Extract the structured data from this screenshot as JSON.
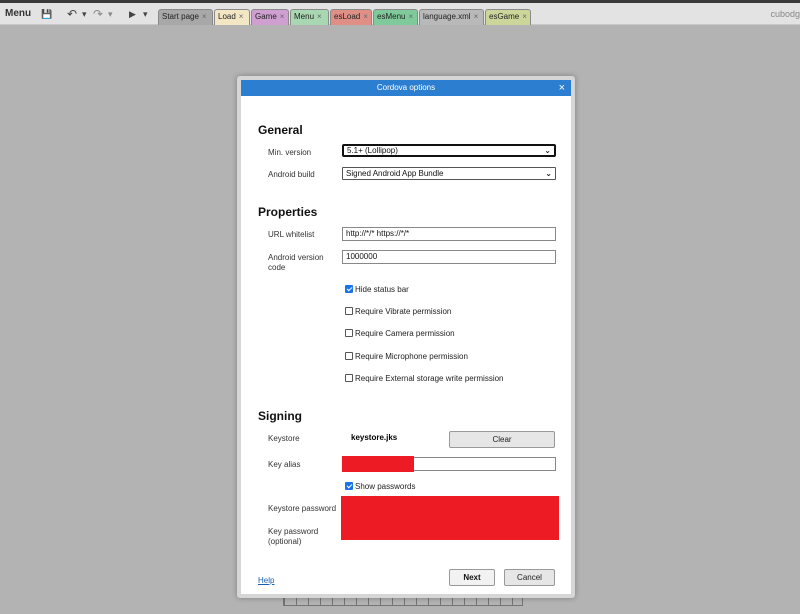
{
  "toolbar": {
    "menu_label": "Menu",
    "save_glyph": "💾",
    "undo_glyph": "↶",
    "redo_glyph": "↷",
    "play_glyph": "▶",
    "dropdown_glyph": "▾",
    "user_label": "cubodg",
    "tabs": [
      {
        "label": "Start page",
        "close": "×",
        "color": "#a8a8a8"
      },
      {
        "label": "Load",
        "close": "×",
        "color": "#f3e6c4"
      },
      {
        "label": "Game",
        "close": "×",
        "color": "#cf9fd1"
      },
      {
        "label": "Menu",
        "close": "×",
        "color": "#a9d7b2"
      },
      {
        "label": "esLoad",
        "close": "×",
        "color": "#df8f86"
      },
      {
        "label": "esMenu",
        "close": "×",
        "color": "#7fc99a"
      },
      {
        "label": "language.xml",
        "close": "×",
        "color": "#b9b9b9"
      },
      {
        "label": "esGame",
        "close": "×",
        "color": "#cdd69a"
      }
    ]
  },
  "dialog": {
    "title": "Cordova options",
    "close_glyph": "×",
    "general": {
      "heading": "General",
      "min_version_label": "Min. version",
      "min_version_value": "5.1+ (Lollipop)",
      "android_build_label": "Android build",
      "android_build_value": "Signed Android App Bundle"
    },
    "properties": {
      "heading": "Properties",
      "url_whitelist_label": "URL whitelist",
      "url_whitelist_value": "http://*/* https://*/*",
      "android_version_label_1": "Android version",
      "android_version_label_2": "code",
      "android_version_value": "1000000",
      "checkboxes": [
        {
          "label": "Hide status bar",
          "checked": true
        },
        {
          "label": "Require Vibrate permission",
          "checked": false
        },
        {
          "label": "Require Camera permission",
          "checked": false
        },
        {
          "label": "Require Microphone permission",
          "checked": false
        },
        {
          "label": "Require External storage write permission",
          "checked": false
        }
      ]
    },
    "signing": {
      "heading": "Signing",
      "keystore_label": "Keystore",
      "keystore_value": "keystore.jks",
      "clear_label": "Clear",
      "key_alias_label": "Key alias",
      "show_passwords_label": "Show passwords",
      "show_passwords_checked": true,
      "keystore_password_label": "Keystore password",
      "key_password_label_1": "Key password",
      "key_password_label_2": "(optional)"
    },
    "footer": {
      "help_label": "Help",
      "next_label": "Next",
      "cancel_label": "Cancel"
    }
  },
  "colors": {
    "title_bar": "#2c7fd0",
    "redaction": "#ed1c24",
    "checkbox_on": "#1a73e8"
  }
}
